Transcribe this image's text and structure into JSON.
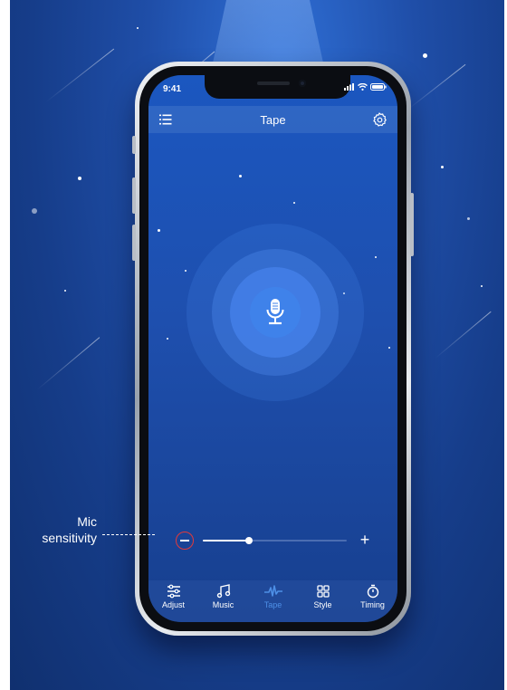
{
  "status_bar": {
    "time": "9:41"
  },
  "header": {
    "title": "Tape"
  },
  "slider": {
    "value": 0.32,
    "plus_symbol": "+"
  },
  "tabs": [
    {
      "label": "Adjust",
      "icon": "sliders-icon",
      "active": false
    },
    {
      "label": "Music",
      "icon": "music-note-icon",
      "active": false
    },
    {
      "label": "Tape",
      "icon": "waveform-icon",
      "active": true
    },
    {
      "label": "Style",
      "icon": "grid-icon",
      "active": false
    },
    {
      "label": "Timing",
      "icon": "timer-icon",
      "active": false
    }
  ],
  "annotation": {
    "line1": "Mic",
    "line2": "sensitivity"
  },
  "colors": {
    "accent": "#4d8fe6",
    "minus_ring": "#e23a3a",
    "background": "#163d8a"
  }
}
